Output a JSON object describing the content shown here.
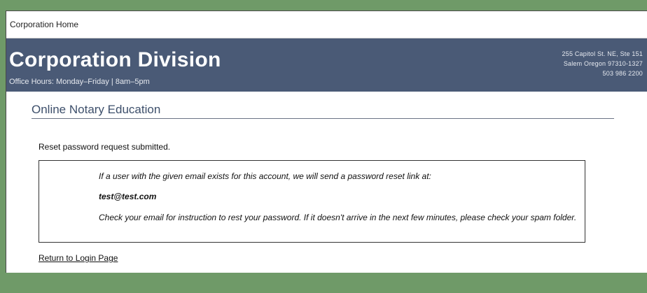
{
  "nav": {
    "home_link": "Corporation Home"
  },
  "banner": {
    "title": "Corporation Division",
    "hours": "Office Hours: Monday–Friday | 8am–5pm",
    "address_line1": "255 Capitol St. NE, Ste 151",
    "address_line2": "Salem  Oregon 97310-1327",
    "phone": "503 986 2200"
  },
  "main": {
    "heading": "Online Notary Education",
    "status": "Reset password request submitted.",
    "info": {
      "line1": "If a user with the given email exists for this account, we will send a password reset link at:",
      "email": "test@test.com",
      "line3": "Check your email for instruction to rest your password. If it doesn't arrive in the next few minutes, please check your spam folder."
    },
    "return_link": "Return to Login Page"
  },
  "colors": {
    "page_background": "#6f9a68",
    "banner_background": "#4a5a76",
    "heading_color": "#3d4f6b"
  }
}
